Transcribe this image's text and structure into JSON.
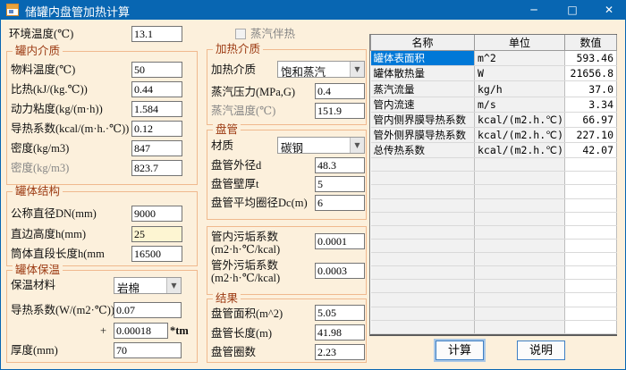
{
  "window": {
    "title": "储罐内盘管加热计算",
    "minimize": "─",
    "maximize": "□",
    "close": "✕"
  },
  "ambient": {
    "label": "环境温度(℃)",
    "value": "13.1"
  },
  "steam_trace": {
    "label": "蒸汽伴热"
  },
  "medium": {
    "title": "罐内介质",
    "fields": [
      {
        "label": "物料温度(℃)",
        "value": "50"
      },
      {
        "label": "比热(kJ/(kg.℃))",
        "value": "0.44"
      },
      {
        "label": "动力粘度(kg/(m·h))",
        "value": "1.584"
      },
      {
        "label": "导热系数(kcal/(m·h.·℃))",
        "value": "0.12"
      },
      {
        "label": "密度(kg/m3)",
        "value": "847"
      },
      {
        "label": "密度(kg/m3)",
        "value": "823.7"
      }
    ]
  },
  "structure": {
    "title": "罐体结构",
    "fields": [
      {
        "label": "公称直径DN(mm)",
        "value": "9000"
      },
      {
        "label": "直边高度h(mm)",
        "value": "25"
      },
      {
        "label": "筒体直段长度h(mm",
        "value": "16500"
      }
    ]
  },
  "insulation": {
    "title": "罐体保温",
    "material_label": "保温材料",
    "material_value": "岩棉",
    "conductivity_label": "导热系数(W/(m2·℃))",
    "conductivity_value": "0.07",
    "plus_sign": "+",
    "slope_value": "0.00018",
    "slope_suffix": "*tm",
    "thickness_label": "厚度(mm)",
    "thickness_value": "70"
  },
  "heating": {
    "title": "加热介质",
    "medium_label": "加热介质",
    "medium_value": "饱和蒸汽",
    "pressure_label": "蒸汽压力(MPa,G)",
    "pressure_value": "0.4",
    "temp_label": "蒸汽温度(℃)",
    "temp_value": "151.9"
  },
  "coil": {
    "title": "盘管",
    "material_label": "材质",
    "material_value": "碳钢",
    "fields": [
      {
        "label": "盘管外径d",
        "value": "48.3"
      },
      {
        "label": "盘管壁厚t",
        "value": "5"
      },
      {
        "label": "盘管平均圈径Dc(m)",
        "value": "6"
      }
    ]
  },
  "fouling": {
    "fields": [
      {
        "label": "管内污垢系数",
        "unit": "(m2·h·℃/kcal)",
        "value": "0.0001"
      },
      {
        "label": "管外污垢系数",
        "unit": "(m2·h·℃/kcal)",
        "value": "0.0003"
      }
    ]
  },
  "results": {
    "title": "结果",
    "fields": [
      {
        "label": "盘管面积(m^2)",
        "value": "5.05"
      },
      {
        "label": "盘管长度(m)",
        "value": "41.98"
      },
      {
        "label": "盘管圈数",
        "value": "2.23"
      }
    ]
  },
  "table": {
    "headers": [
      "名称",
      "单位",
      "数值"
    ],
    "rows": [
      {
        "name": "罐体表面积",
        "unit": "m^2",
        "value": "593.46"
      },
      {
        "name": "罐体散热量",
        "unit": "W",
        "value": "21656.8"
      },
      {
        "name": "蒸汽流量",
        "unit": "kg/h",
        "value": "37.0"
      },
      {
        "name": "管内流速",
        "unit": "m/s",
        "value": "3.34"
      },
      {
        "name": "管内侧界膜导热系数",
        "unit": "kcal/(m2.h.℃)",
        "value": "66.97"
      },
      {
        "name": "管外侧界膜导热系数",
        "unit": "kcal/(m2.h.℃)",
        "value": "227.10"
      },
      {
        "name": "总传热系数",
        "unit": "kcal/(m2.h.℃)",
        "value": "42.07"
      }
    ]
  },
  "buttons": {
    "calculate": "计算",
    "help": "说明"
  },
  "colors": {
    "titlebar": "#0866b2",
    "background": "#fcf0dc",
    "group_border": "#f0b98e",
    "group_title": "#9c3a12",
    "selection": "#0078d7",
    "highlight_input": "#fdf5d2"
  }
}
